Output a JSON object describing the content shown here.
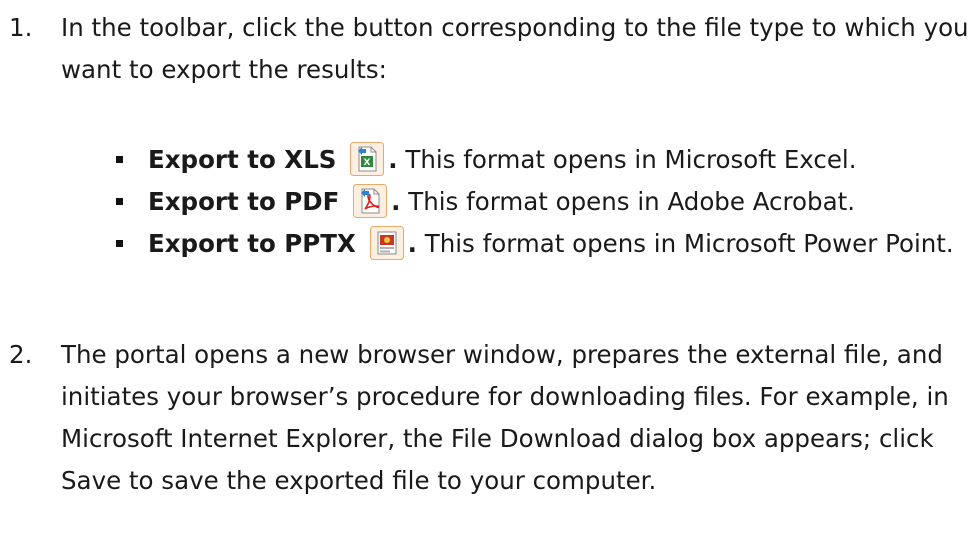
{
  "steps": [
    {
      "number": "1.",
      "text": "In the toolbar, click the button corresponding to the file type to which you want to export the results:"
    },
    {
      "number": "2.",
      "text": "The portal opens a new browser window, prepares the external file, and initiates your browser’s procedure for downloading files. For example, in Microsoft Internet Explorer, the File Download dialog box appears; click Save to save the exported file to your computer."
    }
  ],
  "export_options": [
    {
      "name": "Export to XLS",
      "icon": "excel-export-icon",
      "period": ".",
      "description": " This format opens in Microsoft Excel."
    },
    {
      "name": "Export to PDF",
      "icon": "pdf-export-icon",
      "period": ".",
      "description": " This format opens in Adobe Acrobat."
    },
    {
      "name": "Export to PPTX",
      "icon": "pptx-export-icon",
      "period": ".",
      "description": " This format opens in Microsoft Power Point."
    }
  ],
  "colors": {
    "icon_border": "#e8a96a",
    "icon_background": "#fdf0e2",
    "excel_green": "#2e8b3a",
    "pdf_red": "#d4241c",
    "pptx_red": "#c8371f",
    "arrow_blue": "#2f7fd6"
  }
}
